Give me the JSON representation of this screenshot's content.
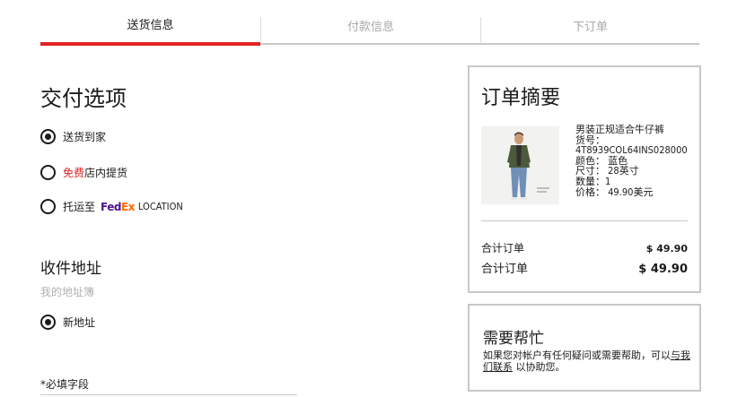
{
  "steps": [
    {
      "label": "送货信息",
      "active": true
    },
    {
      "label": "付款信息",
      "active": false
    },
    {
      "label": "下订单",
      "active": false
    }
  ],
  "delivery": {
    "title": "交付选项",
    "options": [
      {
        "label": "送货到家",
        "checked": true
      },
      {
        "free_label": "免费",
        "label": "店内提货",
        "checked": false
      },
      {
        "label": "托运至",
        "brand_fe": "Fed",
        "brand_ex": "Ex",
        "suffix": "LOCATION",
        "checked": false
      }
    ]
  },
  "address": {
    "title": "收件地址",
    "address_book": "我的地址簿",
    "new_address": "新地址",
    "required_note": "*必填字段"
  },
  "summary": {
    "title": "订单摘要",
    "product": {
      "name": "男装正规适合牛仔裤",
      "item_no": "货号：",
      "sku": "4T8939COL64INS028000",
      "color": "颜色： 蓝色",
      "size": "尺寸： 28英寸",
      "qty": "数量：1",
      "price": "价格： 49.90美元"
    },
    "subtotal_label": "合计订单",
    "subtotal_value": "$ 49.90",
    "total_label": "合计订单",
    "total_value": "$ 49.90"
  },
  "help": {
    "title": "需要帮忙",
    "text_before": "如果您对帐户有任何疑问或需要帮助，可以",
    "link": "与我们联系",
    "text_after": "以协助您。"
  },
  "colors": {
    "accent": "#e02424",
    "fedex_purple": "#4d148c",
    "fedex_orange": "#ff6600"
  }
}
